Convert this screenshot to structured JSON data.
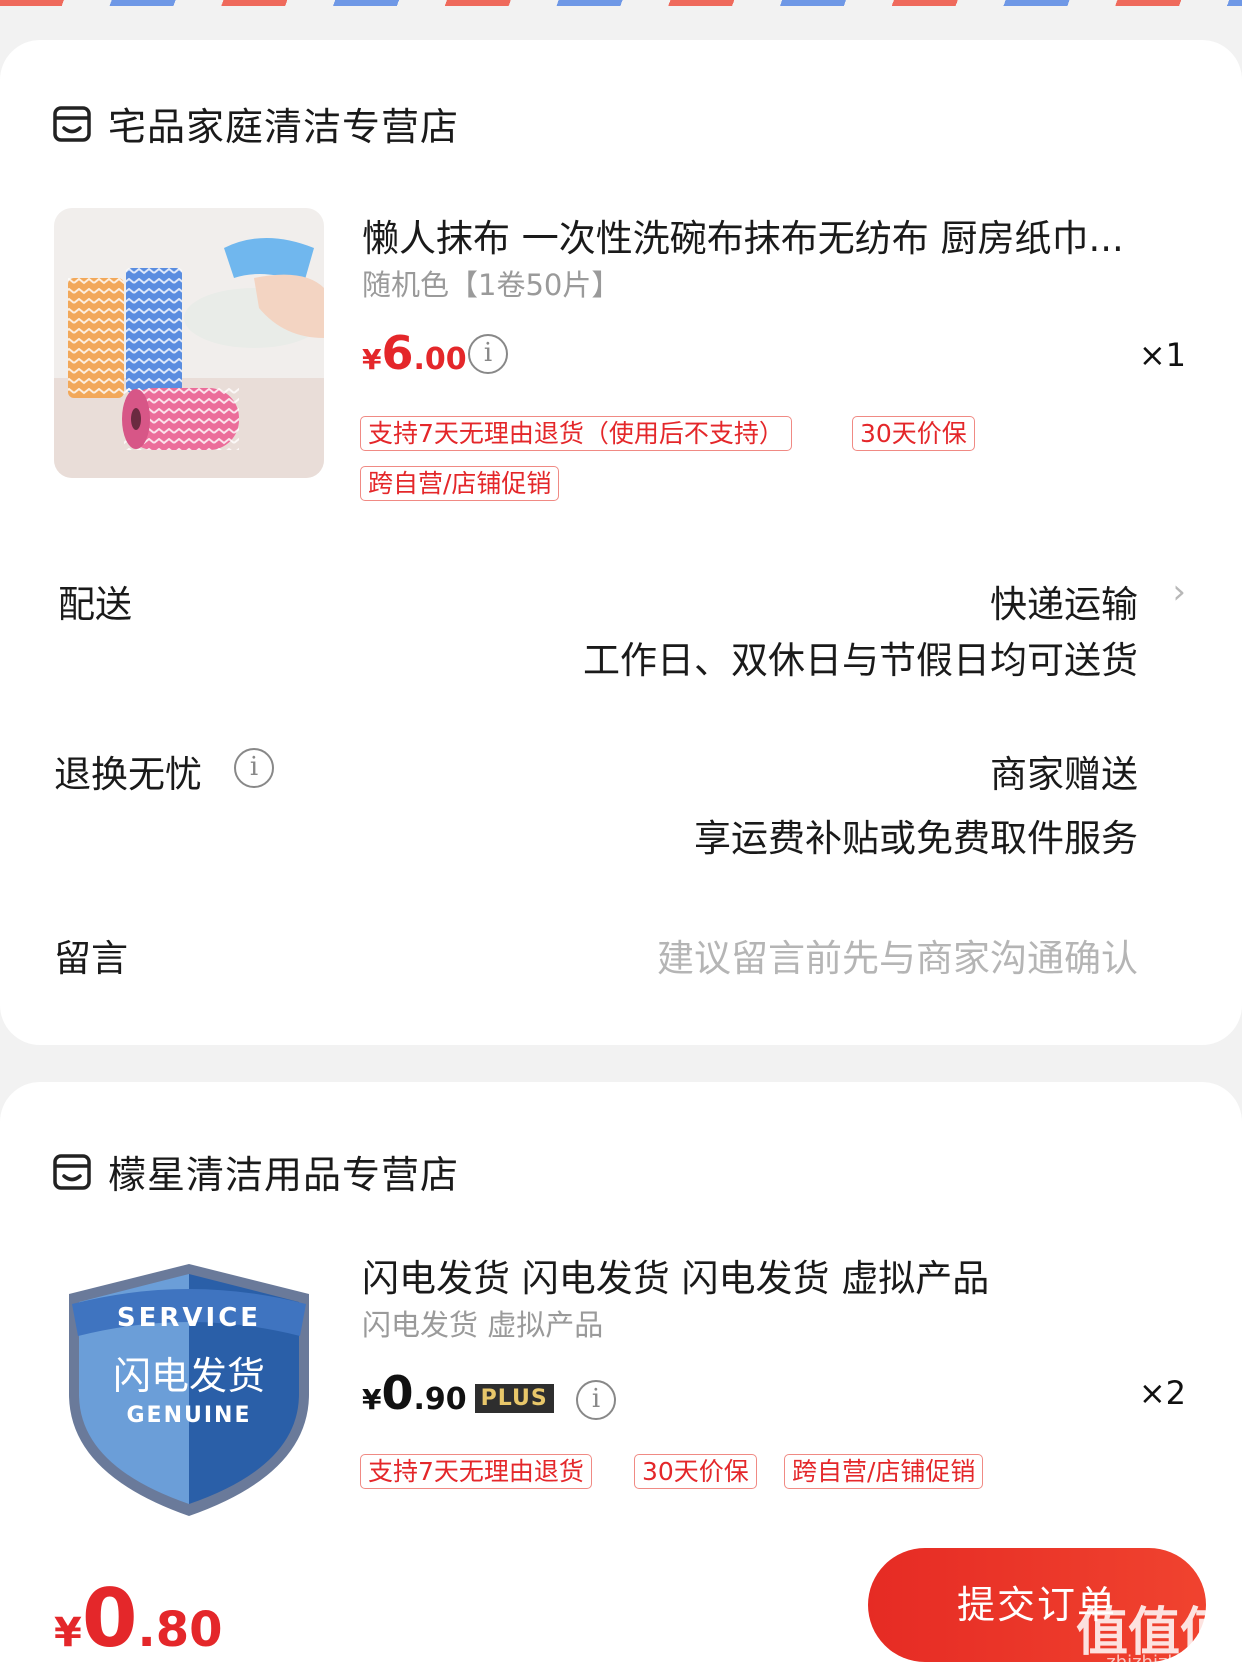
{
  "colors": {
    "accent": "#e4272a",
    "page_bg": "#f2f2f2",
    "card_bg": "#ffffff"
  },
  "store1": {
    "name": "宅品家庭清洁专营店",
    "icon": "store-icon",
    "product": {
      "title": "懒人抹布 一次性洗碗布抹布无纺布 厨房纸巾...",
      "spec": "随机色【1卷50片】",
      "price_symbol": "¥",
      "price_int": "6",
      "price_dec": ".00",
      "quantity": "×1",
      "tags": [
        "支持7天无理由退货（使用后不支持）",
        "30天价保",
        "跨自营/店铺促销"
      ]
    },
    "delivery": {
      "label": "配送",
      "method": "快递运输",
      "detail": "工作日、双休日与节假日均可送货"
    },
    "returns": {
      "label": "退换无忧",
      "value": "商家赠送",
      "detail": "享运费补贴或免费取件服务"
    },
    "message": {
      "label": "留言",
      "placeholder": "建议留言前先与商家沟通确认"
    }
  },
  "store2": {
    "name": "檬星清洁用品专营店",
    "icon": "store-icon",
    "product": {
      "title": "闪电发货 闪电发货 闪电发货 虚拟产品",
      "spec": "闪电发货 虚拟产品",
      "price_symbol": "¥",
      "price_int": "0",
      "price_dec": ".90",
      "plus_badge": "PLUS",
      "quantity": "×2",
      "tags": [
        "支持7天无理由退货",
        "30天价保",
        "跨自营/店铺促销"
      ],
      "thumb_text": {
        "top": "SERVICE",
        "middle": "闪电发货",
        "bottom": "GENUINE"
      }
    }
  },
  "footer": {
    "total_symbol": "¥",
    "total_int": "0",
    "total_dec": ".80",
    "submit_label": "提交订单",
    "watermark": "值值值",
    "watermark_url": "zhizhizhi.com"
  }
}
